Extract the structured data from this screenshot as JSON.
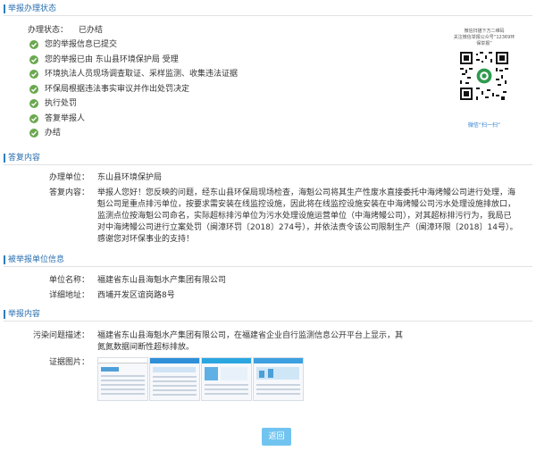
{
  "sections": {
    "status": "举报办理状态",
    "reply": "答复内容",
    "reported_unit": "被举报单位信息",
    "report_content": "举报内容"
  },
  "status": {
    "label": "办理状态：",
    "value": "已办结",
    "steps": [
      "您的举报信息已提交",
      "您的举报已由 东山县环境保护局 受理",
      "环境执法人员现场调查取证、采样监测、收集违法证据",
      "环保局根据违法事实审议并作出处罚决定",
      "执行处罚",
      "答复举报人",
      "办结"
    ]
  },
  "qr": {
    "caption_line1": "微信扫描下方二维码",
    "caption_line2": "关注微信举报公众号“12369环保举报”",
    "label": "微信“扫一扫”"
  },
  "reply": {
    "unit_label": "办理单位：",
    "unit_value": "东山县环境保护局",
    "content_label": "答复内容：",
    "content_value": "举报人您好！您反映的问题，经东山县环保局现场检查，海魁公司将其生产性废水直接委托中海烤鳗公司进行处理，海魁公司是重点排污单位，按要求需安装在线监控设施，因此将在线监控设施安装在中海烤鳗公司污水处理设施排放口，监测点位按海魁公司命名，实际超标排污单位为污水处理设施运营单位（中海烤鳗公司），对其超标排污行为，我局已对中海烤鳗公司进行立案处罚（闽漳环罚〔2018〕274号），并依法责令该公司限制生产（闽漳环限〔2018〕14号）。感谢您对环保事业的支持！"
  },
  "reported_unit": {
    "name_label": "单位名称：",
    "name_value": "福建省东山县海魁水产集团有限公司",
    "address_label": "详细地址：",
    "address_value": "西埔开发区谊岗路8号"
  },
  "report_content": {
    "desc_label": "污染问题描述：",
    "desc_value": "福建省东山县海魁水产集团有限公司，在福建省企业自行监测信息公开平台上显示，其氮氮数据间断性超标排放。",
    "images_label": "证据图片："
  },
  "back_button": "返回",
  "colors": {
    "accent": "#2c7fc1",
    "check": "#6aa84f",
    "button": "#72c4f0"
  }
}
